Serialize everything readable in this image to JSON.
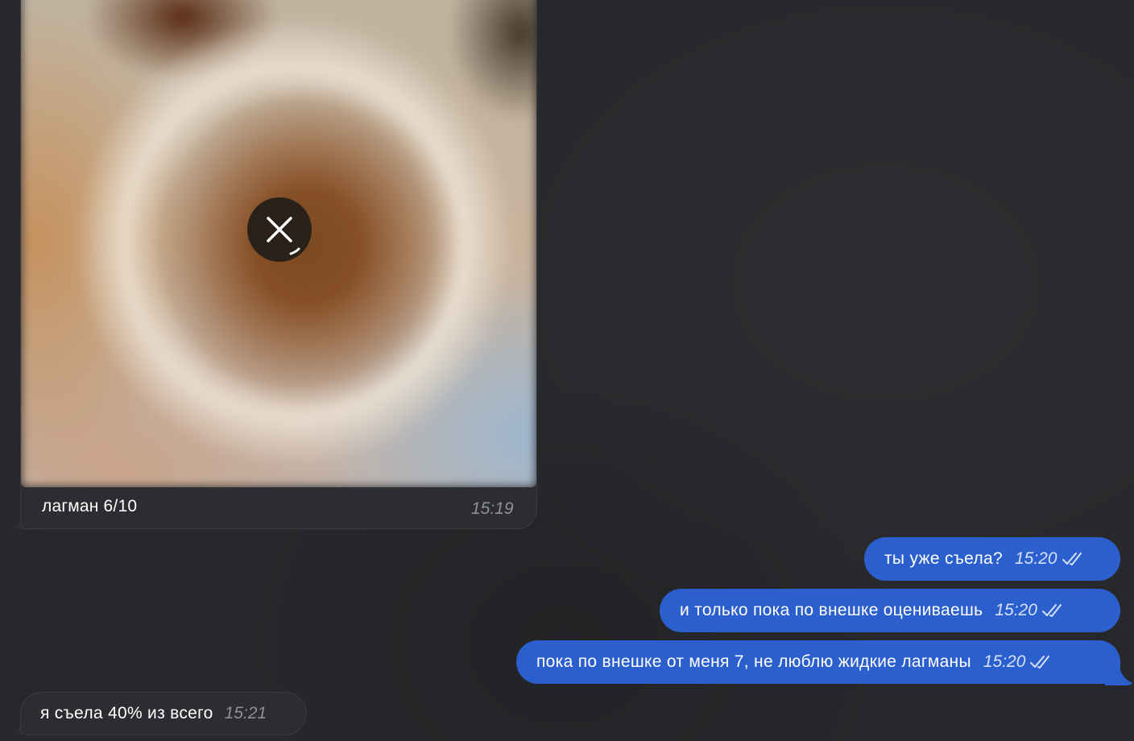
{
  "messages": [
    {
      "direction": "incoming",
      "kind": "photo",
      "caption": "лагман 6/10",
      "time": "15:19",
      "photo_state": "downloading",
      "action_icon": "close-icon"
    },
    {
      "direction": "outgoing",
      "text": "ты уже съела?",
      "time": "15:20",
      "status_icon": "double-check-icon"
    },
    {
      "direction": "outgoing",
      "text": "и только пока по внешке оцениваешь",
      "time": "15:20",
      "status_icon": "double-check-icon"
    },
    {
      "direction": "outgoing",
      "text": "пока по внешке от меня 7, не люблю жидкие лагманы",
      "time": "15:20",
      "status_icon": "double-check-icon"
    },
    {
      "direction": "incoming",
      "text": "я съела 40% из всего",
      "time": "15:21"
    }
  ],
  "colors": {
    "background": "#26282b",
    "incoming_bubble": "#2c2d30",
    "outgoing_bubble": "#2b5fce",
    "incoming_time": "#8d9096",
    "outgoing_time": "#d6e1fb"
  }
}
